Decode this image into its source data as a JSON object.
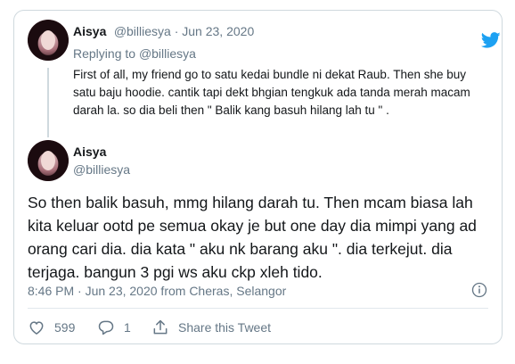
{
  "reply_tweet": {
    "display_name": "Aisya",
    "meta": "@billiesya · Jun 23, 2020",
    "replying_to_prefix": "Replying to",
    "replying_to_handle": "@billiesya",
    "text": "First of all, my friend go to satu kedai bundle ni dekat Raub. Then she buy satu baju hoodie. cantik tapi dekt bhgian tengkuk ada tanda merah macam darah la. so dia beli then  \" Balik kang basuh hilang lah tu \" ."
  },
  "main_tweet": {
    "display_name": "Aisya",
    "handle": "@billiesya",
    "text": "So then balik basuh, mmg hilang darah tu. Then mcam biasa lah kita keluar ootd pe semua okay je but one day dia mimpi yang ad orang cari dia. dia kata \" aku nk barang aku \". dia terkejut. dia terjaga. bangun 3 pgi ws aku ckp xleh tido.",
    "timestamp": "8:46 PM · Jun 23, 2020 from Cheras, Selangor"
  },
  "actions": {
    "likes": "599",
    "replies": "1",
    "share_label": "Share this Tweet"
  },
  "icons": {
    "brand": "twitter-bird-icon",
    "like": "heart-icon",
    "reply": "reply-bubble-icon",
    "share": "share-icon",
    "info": "info-icon"
  },
  "colors": {
    "brand": "#1da1f2",
    "secondary_text": "#657786",
    "border": "#cfd9de"
  }
}
